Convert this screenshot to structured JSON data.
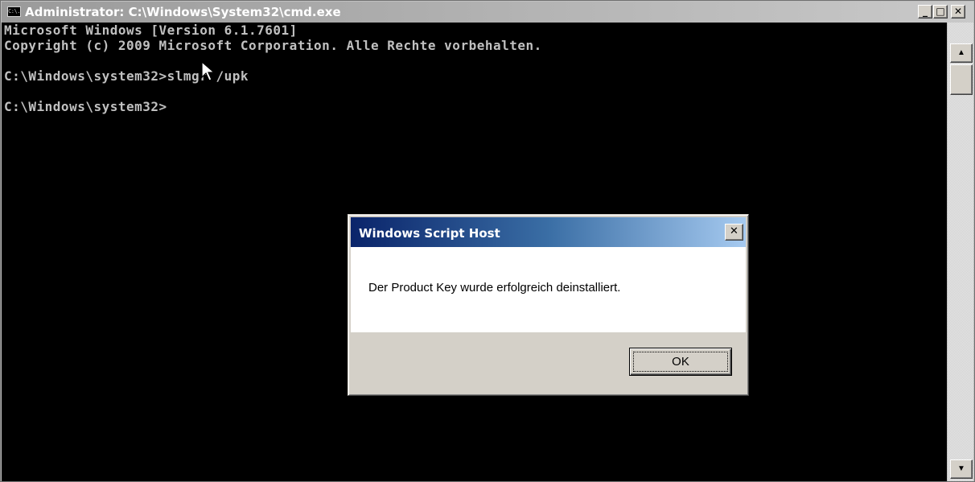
{
  "window": {
    "title": "Administrator: C:\\Windows\\System32\\cmd.exe",
    "icon_text": "C:\\.",
    "minimize_glyph": "_",
    "maximize_glyph": "□",
    "close_glyph": "✕"
  },
  "console": {
    "lines": [
      "Microsoft Windows [Version 6.1.7601]",
      "Copyright (c) 2009 Microsoft Corporation. Alle Rechte vorbehalten.",
      "",
      "C:\\Windows\\system32>slmgr /upk",
      "",
      "C:\\Windows\\system32>"
    ],
    "text_color": "#c0c0c0",
    "background_color": "#000000"
  },
  "scrollbar": {
    "up_glyph": "▲",
    "down_glyph": "▼"
  },
  "dialog": {
    "title": "Windows Script Host",
    "close_glyph": "✕",
    "message": "Der Product Key wurde erfolgreich deinstalliert.",
    "ok_label": "OK",
    "title_gradient_start": "#0a246a",
    "title_gradient_end": "#a6caf0"
  },
  "icons": {
    "mouse_cursor": "arrow-pointer-icon",
    "window_icon": "cmd-icon"
  }
}
